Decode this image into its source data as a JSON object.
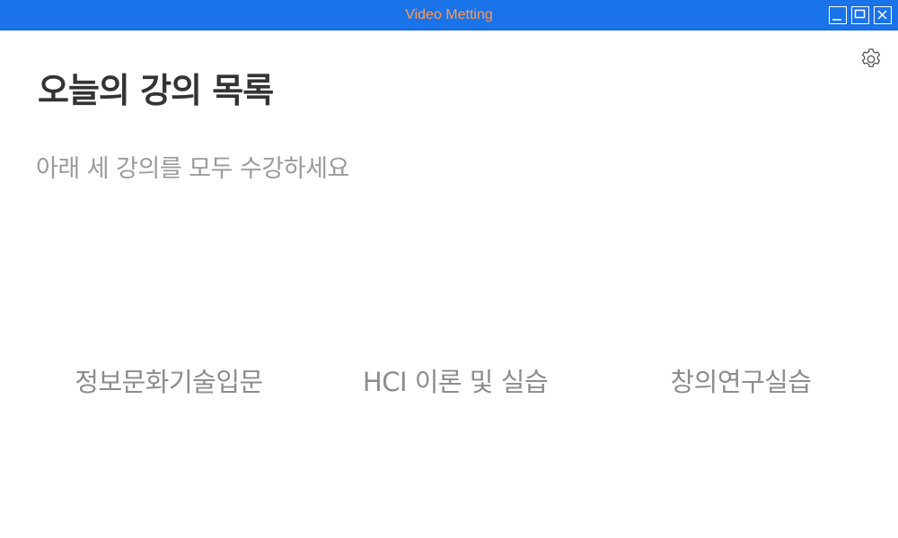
{
  "window": {
    "title": "Video Metting",
    "controls": {
      "minimize_icon": "minimize-icon",
      "maximize_icon": "maximize-icon",
      "close_icon": "close-icon"
    },
    "colors": {
      "titlebar": "#1a73e8",
      "title_text": "#ff9a56"
    }
  },
  "header": {
    "settings_icon": "gear-icon",
    "title": "오늘의 강의 목록",
    "subtitle": "아래 세 강의를 모두 수강하세요"
  },
  "courses": [
    {
      "label": "정보문화기술입문"
    },
    {
      "label": "HCI 이론 및 실습"
    },
    {
      "label": "창의연구실습"
    }
  ]
}
